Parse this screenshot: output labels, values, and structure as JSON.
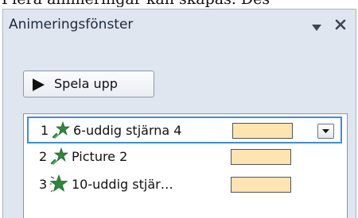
{
  "background_text": "Flera animeringar kan skapas. Des",
  "pane": {
    "title": "Animeringsfönster",
    "menu_icon": "triangle-down",
    "close_icon": "close-x"
  },
  "play_button": {
    "label": "Spela upp",
    "icon": "play-triangle"
  },
  "animation_list": {
    "items": [
      {
        "number": "1",
        "name": "6-uddig stjärna 4",
        "icon": "emphasis-star-icon",
        "selected": true,
        "has_dropdown": true
      },
      {
        "number": "2",
        "name": "Picture 2",
        "icon": "emphasis-star-icon",
        "selected": false,
        "has_dropdown": false
      },
      {
        "number": "3",
        "name": "10-uddig stjär…",
        "icon": "entrance-star-icon",
        "selected": false,
        "has_dropdown": false
      }
    ]
  },
  "colors": {
    "pane_background": "#dfe6ef",
    "selection_border": "#3b8fdc",
    "timing_bar_fill": "#fde4b0",
    "star_green": "#2a8a3a"
  }
}
